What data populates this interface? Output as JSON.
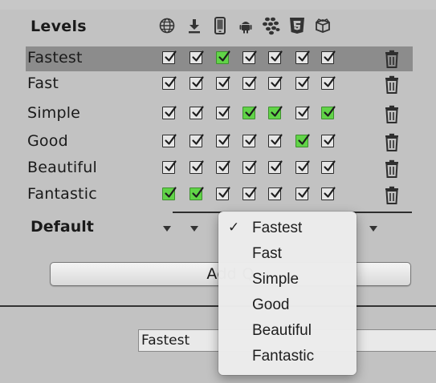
{
  "header": {
    "levels_label": "Levels",
    "platforms": [
      {
        "name": "globe-icon"
      },
      {
        "name": "download-icon"
      },
      {
        "name": "mobile-phone-icon"
      },
      {
        "name": "android-icon"
      },
      {
        "name": "blackberry-icon"
      },
      {
        "name": "html5-icon"
      },
      {
        "name": "box-icon"
      }
    ]
  },
  "levels": [
    {
      "label": "Fastest",
      "selected": true,
      "green": [
        2
      ]
    },
    {
      "label": "Fast",
      "selected": false,
      "green": []
    },
    {
      "label": "Simple",
      "selected": false,
      "green": [
        3,
        4,
        6
      ]
    },
    {
      "label": "Good",
      "selected": false,
      "green": [
        5
      ]
    },
    {
      "label": "Beautiful",
      "selected": false,
      "green": []
    },
    {
      "label": "Fantastic",
      "selected": false,
      "green": [
        0,
        1
      ]
    }
  ],
  "default_row": {
    "label": "Default"
  },
  "add_button": {
    "label": "Add Q"
  },
  "quality_field": {
    "value": "Fastest"
  },
  "dropdown": {
    "check_glyph": "✓",
    "items": [
      {
        "label": "Fastest",
        "checked": true
      },
      {
        "label": "Fast",
        "checked": false
      },
      {
        "label": "Simple",
        "checked": false
      },
      {
        "label": "Good",
        "checked": false
      },
      {
        "label": "Beautiful",
        "checked": false
      },
      {
        "label": "Fantastic",
        "checked": false
      }
    ]
  },
  "colors": {
    "checkbox_green": "#61d448",
    "selected_row": "#8c8c8c",
    "panel_bg": "#c2c2c2"
  }
}
